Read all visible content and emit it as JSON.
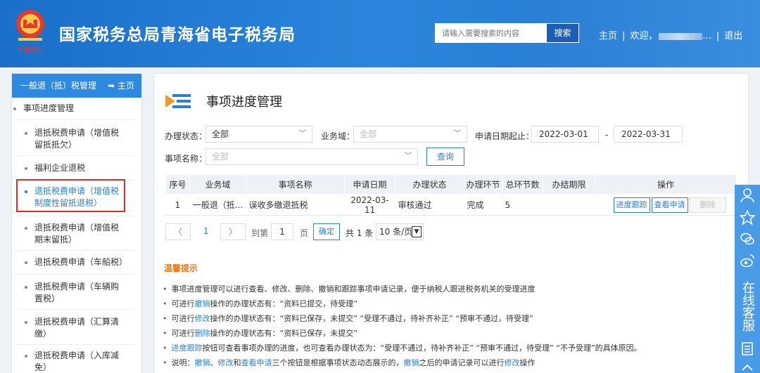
{
  "header": {
    "title": "国家税务总局青海省电子税务局",
    "search_placeholder": "请输入需要搜索的内容",
    "search_button": "搜索",
    "nav_home": "主页",
    "nav_welcome": "欢迎，",
    "nav_user_suffix": "...",
    "nav_logout": "退出",
    "emblem_text": "中国税务"
  },
  "sidebar": {
    "heading": "一般退（抵）税管理",
    "home": "主页",
    "items": [
      {
        "label": "事项进度管理"
      },
      {
        "label": "退抵税费申请（增值税留抵抵欠）"
      },
      {
        "label": "福利企业退税"
      },
      {
        "label": "退抵税费申请（增值税制度性留抵退税）"
      },
      {
        "label": "退抵税费申请（增值税期末留抵）"
      },
      {
        "label": "退抵税费申请（车船税）"
      },
      {
        "label": "退抵税费申请（车辆购置税）"
      },
      {
        "label": "退抵税费申请（汇算清缴）"
      },
      {
        "label": "退抵税费申请（入库减免）"
      }
    ]
  },
  "main": {
    "title": "事项进度管理",
    "filters": {
      "status_label": "办理状态：",
      "status_value": "全部",
      "domain_label": "业务域：",
      "domain_value": "全部",
      "date_label": "申请日期起止：",
      "date_from": "2022-03-01",
      "date_sep": "-",
      "date_to": "2022-03-31",
      "item_label": "事项名称：",
      "item_value": "全部",
      "query_button": "查询"
    },
    "table": {
      "headers": [
        "序号",
        "业务域",
        "事项名称",
        "申请日期",
        "办理状态",
        "办理环节",
        "总环节数",
        "办结期限",
        "操作"
      ],
      "rows": [
        {
          "no": "1",
          "domain": "一般退（抵...",
          "name": "误收多缴退抵税",
          "date": "2022-03-11",
          "status": "审核通过",
          "stage": "完成",
          "total": "5",
          "deadline": ""
        }
      ],
      "actions": {
        "track": "进度跟踪",
        "view": "查看申请",
        "delete": "删除"
      }
    },
    "pager": {
      "prev": "〈",
      "current": "1",
      "next": "〉",
      "goto": "到第",
      "goto_value": "1",
      "page_unit": "页",
      "confirm": "确定",
      "total": "共 1 条",
      "page_size": "10 条/页"
    },
    "tips": {
      "title": "温馨提示",
      "l1": "事项进度管理可以进行查看、修改、删除、撤销和跟踪事项申请记录，便于纳税人跟进税务机关的受理进度",
      "l2a": "可进行",
      "l2b": "撤销",
      "l2c": "操作的办理状态有：“资料已提交，待受理”",
      "l3a": "可进行",
      "l3b": "修改",
      "l3c": "操作的办理状态有：“资料已保存，未提交”  “受理不通过，待补齐补正”  “预审不通过，待受理”",
      "l4a": "可进行",
      "l4b": "删除",
      "l4c": "操作的办理状态有：“资料已保存，未提交”",
      "l5a": "进度跟踪",
      "l5b": "按钮可查看事项办理的进度，也可查看办理状态为：“受理不通过，待补齐补正”  “预审不通过，待受理”  “不予受理”的具体原因。",
      "l6a": "说明：",
      "l6b": "撤销",
      "l6c": "、",
      "l6d": "修改",
      "l6e": "和",
      "l6f": "查看申请",
      "l6g": "三个按钮是根据事项状态动态展示的，",
      "l6h": "撤销",
      "l6i": "之后的申请记录可以进行",
      "l6j": "修改",
      "l6k": "操作"
    }
  },
  "float_bar": {
    "text": "在线客服"
  }
}
